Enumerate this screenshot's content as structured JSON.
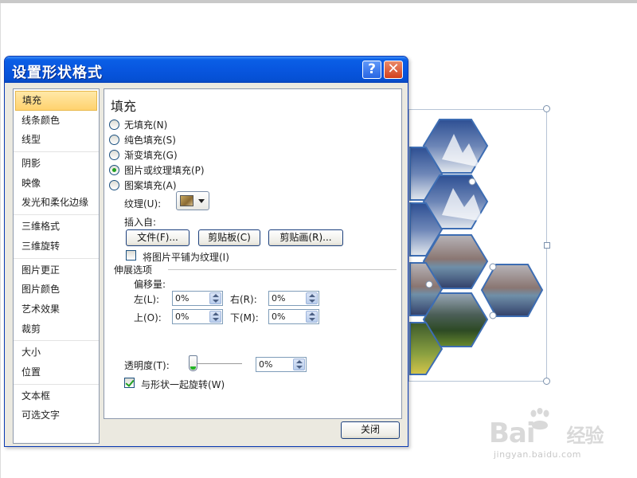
{
  "dialog": {
    "title": "设置形状格式",
    "help_label": "?",
    "close_x_label": "✕",
    "close_button_label": "关闭"
  },
  "sidebar": {
    "items": [
      "填充",
      "线条颜色",
      "线型",
      "阴影",
      "映像",
      "发光和柔化边缘",
      "三维格式",
      "三维旋转",
      "图片更正",
      "图片颜色",
      "艺术效果",
      "裁剪",
      "大小",
      "位置",
      "文本框",
      "可选文字"
    ],
    "active": "填充"
  },
  "panel": {
    "title": "填充",
    "radios": {
      "none": "无填充(N)",
      "solid": "纯色填充(S)",
      "gradient": "渐变填充(G)",
      "picture": "图片或纹理填充(P)",
      "pattern": "图案填充(A)"
    },
    "selected_radio": "图片或纹理填充(P)",
    "texture_label": "纹理(U):",
    "insert_from_label": "插入自:",
    "file_button": "文件(F)...",
    "clipboard_button": "剪贴板(C)",
    "clipart_button": "剪贴画(R)...",
    "tile_checkbox": "将图片平铺为纹理(I)",
    "tile_checked": false,
    "stretch_section": "伸展选项",
    "offset_label": "偏移量:",
    "left_label": "左(L):",
    "right_label": "右(R):",
    "top_label": "上(O):",
    "bottom_label": "下(M):",
    "left_value": "0%",
    "right_value": "0%",
    "top_value": "0%",
    "bottom_value": "0%",
    "transparency_label": "透明度(T):",
    "transparency_value": "0%",
    "transparency_level_percent": 0,
    "rotate_checkbox": "与形状一起旋转(W)",
    "rotate_checked": true
  },
  "watermark": {
    "logo": "Bai",
    "logo_end": "经验",
    "site": "jingyan.baidu.com"
  },
  "colors": {
    "titlebar": "#0856df",
    "active_item": "#ffd26e",
    "hex_border": "#3d6db3",
    "selection_border": "#b6c4d6"
  }
}
